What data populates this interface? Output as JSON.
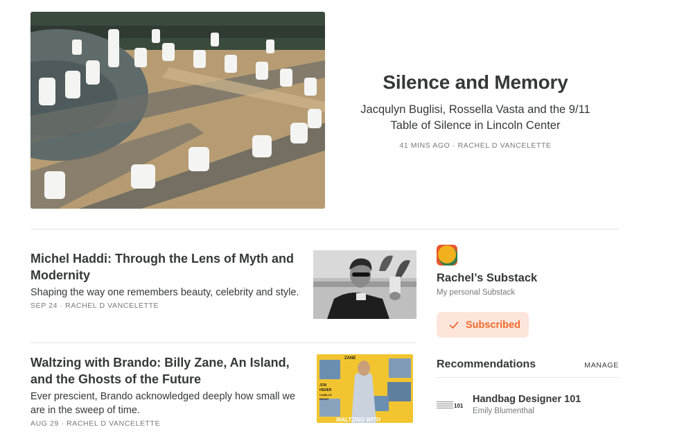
{
  "hero": {
    "title": "Silence and Memory",
    "subtitle": "Jacqulyn Buglisi, Rossella Vasta and the 9/11 Table of Silence in Lincoln Center",
    "meta": "41 MINS AGO · RACHEL D VANCELETTE"
  },
  "posts": [
    {
      "title": "Michel Haddi: Through the Lens of Myth and Modernity",
      "subtitle": "Shaping the way one remembers beauty, celebrity and style.",
      "meta": "SEP 24 · RACHEL D VANCELETTE"
    },
    {
      "title": "Waltzing with Brando: Billy Zane, An Island, and the Ghosts of the Future",
      "subtitle": "Ever prescient, Brando acknowledged deeply how small we are in the sweep of time.",
      "meta": "AUG 29 · RACHEL D VANCELETTE",
      "poster_text": {
        "top": "ZANE",
        "left1": "JON",
        "left2": "HEDER",
        "left3": "CAMILLE",
        "left4": "RAZAT",
        "bottom": "WALTZING WITH"
      }
    }
  ],
  "sidebar": {
    "publication_name": "Rachel’s Substack",
    "publication_description": "My personal Substack",
    "subscribed_label": "Subscribed",
    "recommendations_title": "Recommendations",
    "manage_label": "MANAGE",
    "recommendations": [
      {
        "name": "Handbag Designer 101",
        "author": "Emily Blumenthal",
        "logo_text": "101"
      }
    ]
  },
  "colors": {
    "accent": "#f06b2b",
    "accent_bg": "#fde5dc",
    "text": "#363737",
    "muted": "#77787a",
    "divider": "#e6e6e6"
  }
}
